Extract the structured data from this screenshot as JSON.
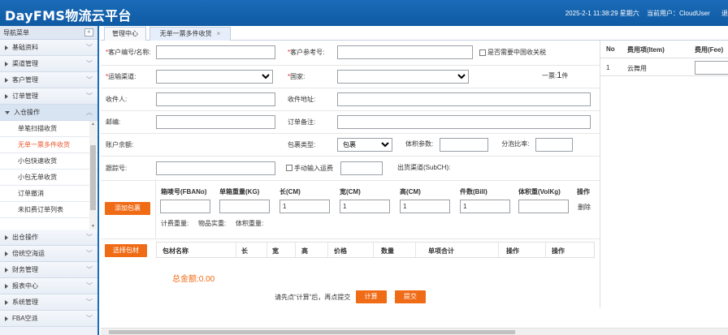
{
  "header": {
    "title": "DayFMS物流云平台",
    "datetime": "2025-2-1 11:38:29 星期六",
    "user_label": "当前用户：",
    "user_name": "CloudUser",
    "extra": "退"
  },
  "sidebar": {
    "title": "导航菜单",
    "collapse": "«",
    "groups_top": [
      "基础资料",
      "渠道管理",
      "客户管理",
      "订单管理"
    ],
    "active_group": "入仓操作",
    "sub_items": [
      "单笔扫描收货",
      "无单一票多件收货",
      "小包快速收货",
      "小包无单收货",
      "订单撤消",
      "未扣费订单列表"
    ],
    "groups_bottom": [
      "出仓操作",
      "倍统空海运",
      "财务管理",
      "报表中心",
      "系统管理",
      "FBA空派"
    ]
  },
  "tabs": [
    {
      "label": "管理中心"
    },
    {
      "label": "无单一票多件收货",
      "close": "×"
    }
  ],
  "form": {
    "customer_code": "客户编号/名称:",
    "customer_ref": "客户参考号:",
    "customs_check": "是否需要中国收关税",
    "channel": "运输渠道:",
    "country": "国家:",
    "piece_prefix": "一票:",
    "piece_count": "1",
    "piece_suffix": "件",
    "receiver": "收件人:",
    "receiver_addr": "收件地址:",
    "postcode": "邮编:",
    "order_note": "订单备注:",
    "balance": "账户余额:",
    "pkg_type": "包裹类型:",
    "pkg_type_value": "包裹",
    "vol_param": "体积参数:",
    "split_ratio": "分泡比率:",
    "tracking": "跟踪号:",
    "manual_fee": "手动输入运费",
    "sub_channel": "出货渠道(SubCH):"
  },
  "boxes": {
    "add_btn": "添加包裹",
    "headers": [
      "箱唛号(FBANo)",
      "单箱重量(KG)",
      "长(CM)",
      "宽(CM)",
      "高(CM)",
      "件数(Bill)",
      "体积重(VolKg)",
      "操作"
    ],
    "row": {
      "len": "1",
      "wid": "1",
      "hei": "1",
      "bill": "1",
      "action": "删除"
    },
    "calc_weight": "计费重量:",
    "actual_weight": "物品实重:",
    "vol_weight": "体积重量:"
  },
  "materials": {
    "select_btn": "选择包材",
    "headers": [
      "包材名称",
      "长",
      "宽",
      "高",
      "价格",
      "数量",
      "单项合计",
      "操作",
      "操作"
    ],
    "total": "总金额:0.00"
  },
  "footer": {
    "hint": "请先点“计算”后，再点提交",
    "calc_btn": "计算",
    "submit_btn": "提交"
  },
  "fees": {
    "headers": [
      "No",
      "费用项(Item)",
      "费用(Fee)"
    ],
    "rows": [
      {
        "no": "1",
        "item": "云舞用"
      }
    ]
  },
  "colors": {
    "header_blue": "#1a6bb8",
    "accent_orange": "#f06b16",
    "selected_red": "#e8572e"
  }
}
